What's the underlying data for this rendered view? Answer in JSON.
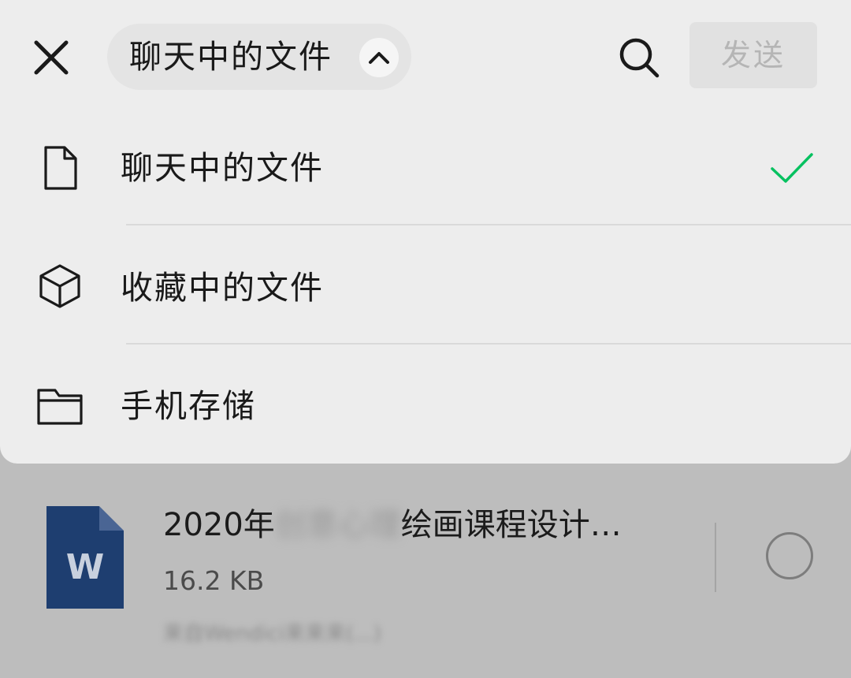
{
  "header": {
    "close_icon": "close-icon",
    "title": "聊天中的文件",
    "chevron_icon": "chevron-up-icon",
    "search_icon": "search-icon",
    "send_label": "发送"
  },
  "menu": {
    "items": [
      {
        "icon": "file-icon",
        "label": "聊天中的文件",
        "selected": true
      },
      {
        "icon": "cube-icon",
        "label": "收藏中的文件",
        "selected": false
      },
      {
        "icon": "folder-icon",
        "label": "手机存储",
        "selected": false
      }
    ],
    "check_color": "#07c160"
  },
  "file_list": {
    "items": [
      {
        "icon": "word-doc-icon",
        "icon_letter": "W",
        "name_prefix": "2020年",
        "name_blurred": "创意心理",
        "name_suffix": "绘画课程设计…",
        "size": "16.2 KB",
        "source_blurred": "来自Wendici来来来(...)"
      }
    ]
  },
  "colors": {
    "sheet_bg": "#ededed",
    "dim_overlay": "#bdbdbd",
    "word_blue": "#1e3e70",
    "send_disabled_bg": "#e1e1e1",
    "send_disabled_text": "#b5b5b5"
  }
}
